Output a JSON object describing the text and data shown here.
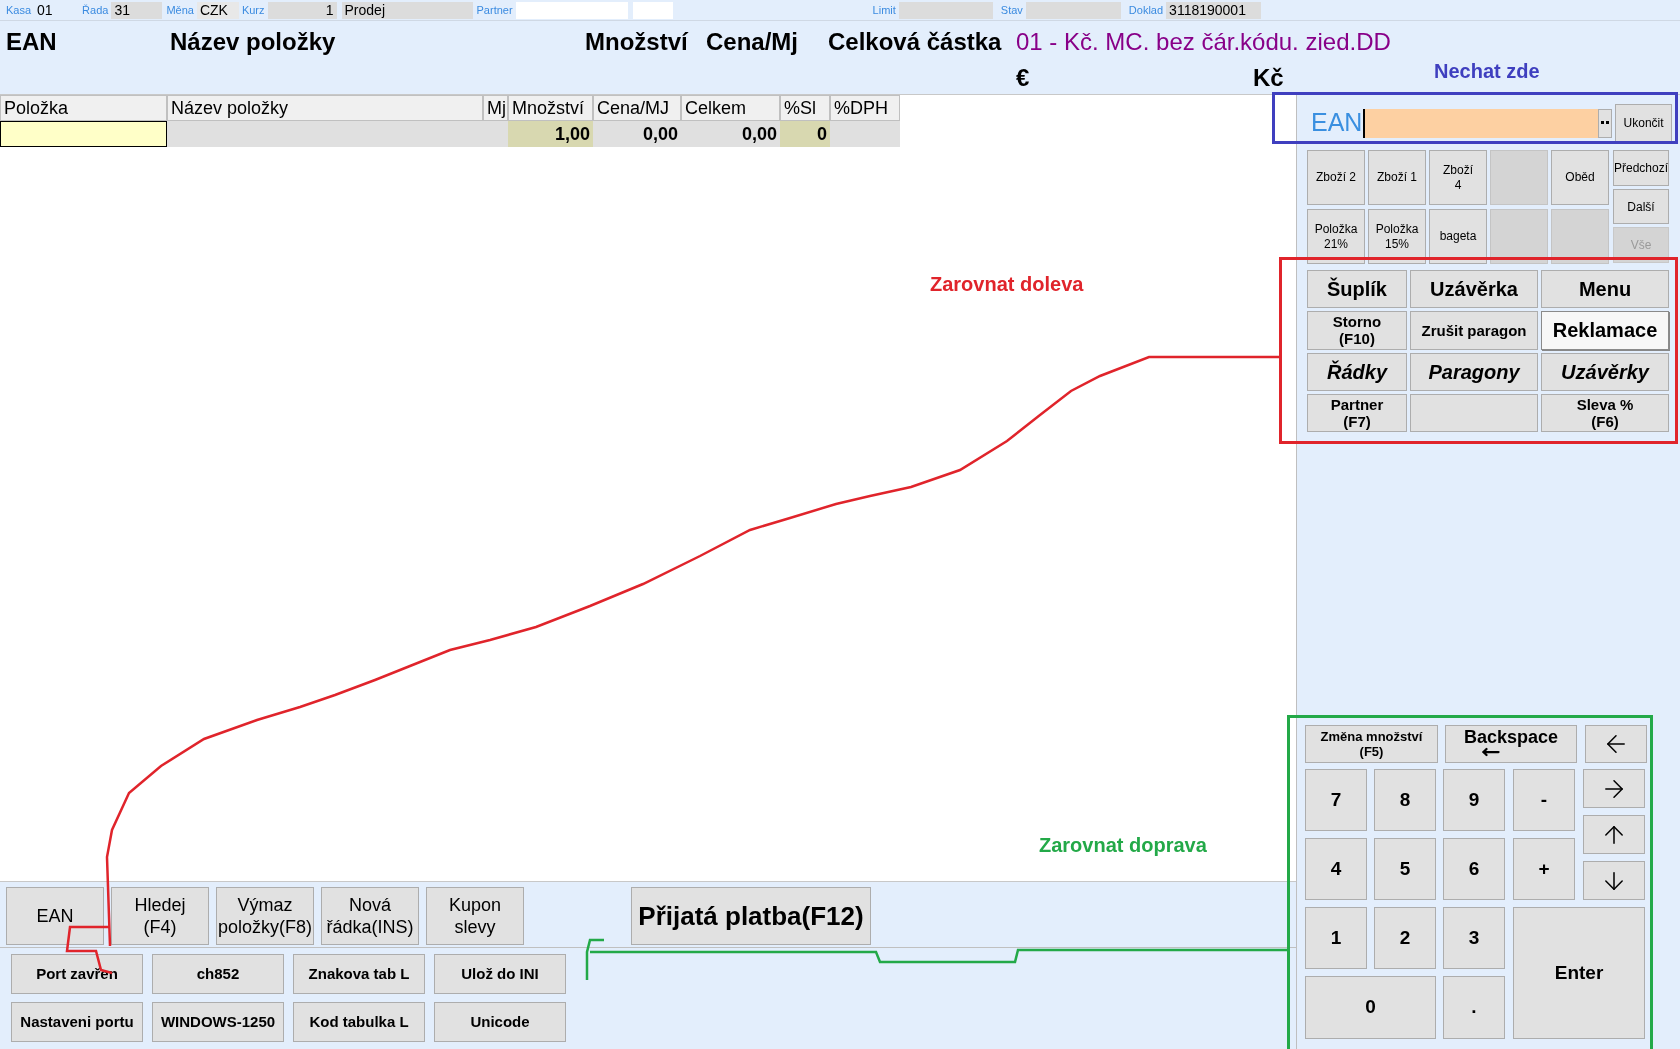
{
  "top_bar": [
    {
      "label": "Kasa",
      "value": "01",
      "kind": "plain"
    },
    {
      "label": "Řada",
      "value": "31",
      "kind": "grey"
    },
    {
      "label": "Měna",
      "value": "CZK",
      "kind": "light"
    },
    {
      "label": "Kurz",
      "value": "1",
      "kind": "number"
    },
    {
      "value": "Prodej",
      "kind": "grey"
    },
    {
      "label": "Partner",
      "kind": "white"
    },
    {
      "kind": "white"
    },
    {
      "label": "Limit",
      "kind": "grey"
    },
    {
      "label": "Stav",
      "kind": "grey"
    },
    {
      "label": "Doklad",
      "value": "3118190001",
      "kind": "grey"
    }
  ],
  "header": {
    "columns": [
      "EAN",
      "Název položky",
      "Množství",
      "Cena/Mj",
      "Celková částka"
    ],
    "info": "01 - Kč. MC. bez čár.kódu. zied.DD",
    "currency_1": "€",
    "currency_2": "Kč"
  },
  "table": {
    "columns": [
      "Položka",
      "Název položky",
      "Mj",
      "Množství",
      "Cena/MJ",
      "Celkem",
      "%Sl",
      "%DPH"
    ],
    "rows": [
      [
        "",
        "",
        "",
        "1,00",
        "0,00",
        "0,00",
        "0",
        ""
      ]
    ]
  },
  "bottom_buttons": [
    "EAN",
    "Hledej\n(F4)",
    "Výmaz\npoložky(F8)",
    "Nová\nřádka(INS)",
    "Kupon\nslevy"
  ],
  "payment_button": "Přijatá platba(F12)",
  "settings_buttons": [
    "Port zavřen",
    "ch852",
    "Znakova tab L",
    "Ulož do INI",
    "Nastaveni portu",
    "WINDOWS-1250",
    "Kod tabulka L",
    "Unicode"
  ],
  "ean_entry": {
    "label": "EAN",
    "close_button": "Ukončit"
  },
  "item_buttons": [
    {
      "kind": "item",
      "label": "Zboží 2"
    },
    {
      "kind": "item",
      "label": "Zboží 1"
    },
    {
      "kind": "item",
      "label": "Zboží\n4"
    },
    {
      "kind": "empty"
    },
    {
      "kind": "item",
      "label": "Oběd"
    },
    {
      "kind": "item",
      "label": "Položka\n21%"
    },
    {
      "kind": "item",
      "label": "Položka\n15%"
    },
    {
      "kind": "item",
      "label": "bageta"
    },
    {
      "kind": "empty"
    },
    {
      "kind": "empty"
    }
  ],
  "page_buttons": [
    {
      "label": "Předchozí",
      "disabled": false
    },
    {
      "label": "Další",
      "disabled": false
    },
    {
      "label": "Vše",
      "disabled": true
    }
  ],
  "function_buttons": [
    {
      "kind": "big",
      "label": "Šuplík",
      "highlighted": false
    },
    {
      "kind": "big",
      "label": "Uzávěrka",
      "highlighted": false
    },
    {
      "kind": "big",
      "label": "Menu",
      "highlighted": false
    },
    {
      "kind": "small",
      "label": "Storno\n(F10)",
      "highlighted": false
    },
    {
      "kind": "small",
      "label": "Zrušit paragon",
      "highlighted": false
    },
    {
      "kind": "big",
      "label": "Reklamace",
      "highlighted": true
    },
    {
      "kind": "italic",
      "label": "Řádky",
      "highlighted": false
    },
    {
      "kind": "italic",
      "label": "Paragony",
      "highlighted": false
    },
    {
      "kind": "italic",
      "label": "Uzávěrky",
      "highlighted": false
    },
    {
      "kind": "small",
      "label": "Partner\n(F7)",
      "highlighted": false
    },
    {
      "kind": "empty",
      "highlighted": false
    },
    {
      "kind": "small",
      "label": "Sleva %\n(F6)",
      "highlighted": false
    }
  ],
  "keypad": {
    "quantity_button": "Změna množství\n(F5)",
    "backspace_button": "Backspace",
    "keys": [
      "7",
      "8",
      "9",
      "-",
      "4",
      "5",
      "6",
      "+",
      "1",
      "2",
      "3",
      "Enter",
      "0",
      "."
    ]
  },
  "annotations": [
    {
      "text": "Nechat zde",
      "color": "#3f3fbf"
    },
    {
      "text": "Zarovnat doleva",
      "color": "#e0242b"
    },
    {
      "text": "Zarovnat doprava",
      "color": "#23a948"
    }
  ]
}
